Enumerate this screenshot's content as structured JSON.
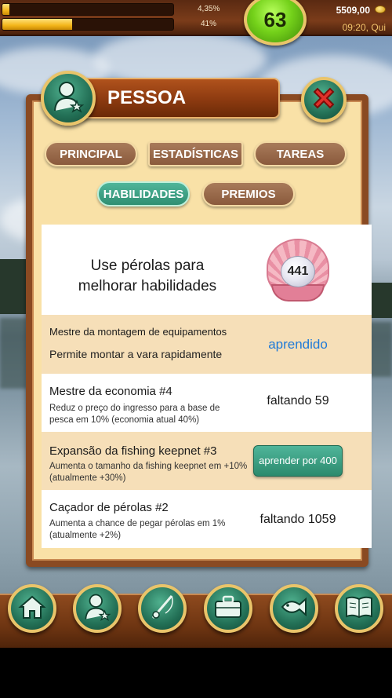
{
  "hud": {
    "xp_percent_text": "4,35%",
    "xp_fraction": 0.0435,
    "energy_percent_text": "41%",
    "energy_fraction": 0.41,
    "level": "63",
    "coins": "5509,00",
    "clock": "09:20, Qui"
  },
  "window": {
    "title": "PESSOA"
  },
  "tabs": [
    {
      "label": "PRINCIPAL",
      "active": false
    },
    {
      "label": "ESTADÍSTICAS",
      "active": false
    },
    {
      "label": "TAREAS",
      "active": false
    },
    {
      "label": "HABILIDADES",
      "active": true
    },
    {
      "label": "PREMIOS",
      "active": false
    }
  ],
  "skills_header": {
    "text_line1": "Use pérolas para",
    "text_line2": "melhorar habilidades",
    "pearls": "441"
  },
  "skills": [
    {
      "name": "Mestre da montagem de equipamentos",
      "description": "Permite montar a vara rapidamente",
      "status": "aprendido"
    },
    {
      "name": "Mestre da economia #4",
      "description": "Reduz o preço do ingresso para a base de pesca em 10% (economia atual 40%)",
      "status": "faltando 59"
    },
    {
      "name": "Expansão da fishing keepnet #3",
      "description": "Aumenta o tamanho da fishing keepnet em +10% (atualmente +30%)",
      "button": "aprender por 400"
    },
    {
      "name": "Caçador de pérolas #2",
      "description": "Aumenta a chance de pegar pérolas em 1% (atualmente +2%)",
      "status": "faltando 1059"
    }
  ],
  "nav": [
    "home-icon",
    "profile-icon",
    "fishing-rod-icon",
    "briefcase-icon",
    "fish-icon",
    "book-icon"
  ],
  "colors": {
    "accent_green": "#2f8f72",
    "learned_blue": "#1f7ad8",
    "wood_brown": "#8a4a22",
    "panel_cream": "#f9e1a7"
  }
}
